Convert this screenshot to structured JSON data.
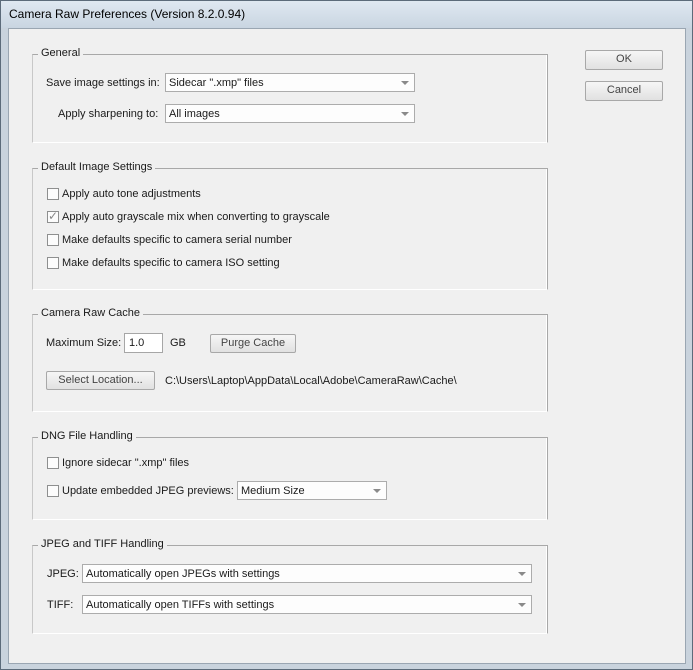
{
  "window": {
    "title": "Camera Raw Preferences  (Version 8.2.0.94)"
  },
  "buttons": {
    "ok": "OK",
    "cancel": "Cancel"
  },
  "general": {
    "legend": "General",
    "save_label": "Save image settings in:",
    "save_value": "Sidecar \".xmp\" files",
    "sharpen_label": "Apply sharpening to:",
    "sharpen_value": "All images"
  },
  "defaults": {
    "legend": "Default Image Settings",
    "options": [
      {
        "label": "Apply auto tone adjustments",
        "checked": false
      },
      {
        "label": "Apply auto grayscale mix when converting to grayscale",
        "checked": true
      },
      {
        "label": "Make defaults specific to camera serial number",
        "checked": false
      },
      {
        "label": "Make defaults specific to camera ISO setting",
        "checked": false
      }
    ]
  },
  "cache": {
    "legend": "Camera Raw Cache",
    "max_size_label": "Maximum Size:",
    "max_size_value": "1.0",
    "unit": "GB",
    "purge_label": "Purge Cache",
    "select_location_label": "Select Location...",
    "path": "C:\\Users\\Laptop\\AppData\\Local\\Adobe\\CameraRaw\\Cache\\"
  },
  "dng": {
    "legend": "DNG File Handling",
    "ignore_label": "Ignore sidecar \".xmp\" files",
    "ignore_checked": false,
    "update_label": "Update embedded JPEG previews:",
    "update_checked": false,
    "preview_value": "Medium Size"
  },
  "jpeg_tiff": {
    "legend": "JPEG and TIFF Handling",
    "jpeg_label": "JPEG:",
    "jpeg_value": "Automatically open JPEGs with settings",
    "tiff_label": "TIFF:",
    "tiff_value": "Automatically open TIFFs with settings"
  },
  "colors": {
    "accent": "#3c7fb1",
    "background": "#f0f0f0"
  }
}
